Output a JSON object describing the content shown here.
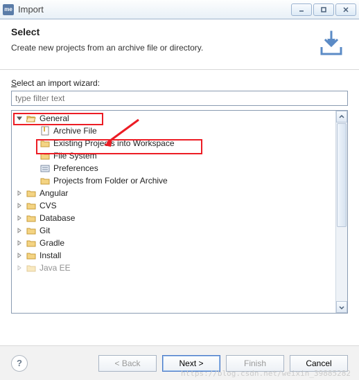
{
  "titlebar": {
    "app_label": "me",
    "title": "Import"
  },
  "header": {
    "title": "Select",
    "description": "Create new projects from an archive file or directory."
  },
  "wizard": {
    "label_prefix": "S",
    "label_rest": "elect an import wizard:",
    "filter_placeholder": "type filter text"
  },
  "tree": {
    "general": {
      "label": "General",
      "children": {
        "archive": "Archive File",
        "existing": "Existing Projects into Workspace",
        "filesystem": "File System",
        "prefs": "Preferences",
        "folder": "Projects from Folder or Archive"
      }
    },
    "collapsed": {
      "angular": "Angular",
      "cvs": "CVS",
      "database": "Database",
      "git": "Git",
      "gradle": "Gradle",
      "install": "Install",
      "javaee": "Java EE"
    }
  },
  "buttons": {
    "back": "< Back",
    "next": "Next >",
    "finish": "Finish",
    "cancel": "Cancel"
  },
  "watermark": "https://blog.csdn.net/weixin_39885282"
}
